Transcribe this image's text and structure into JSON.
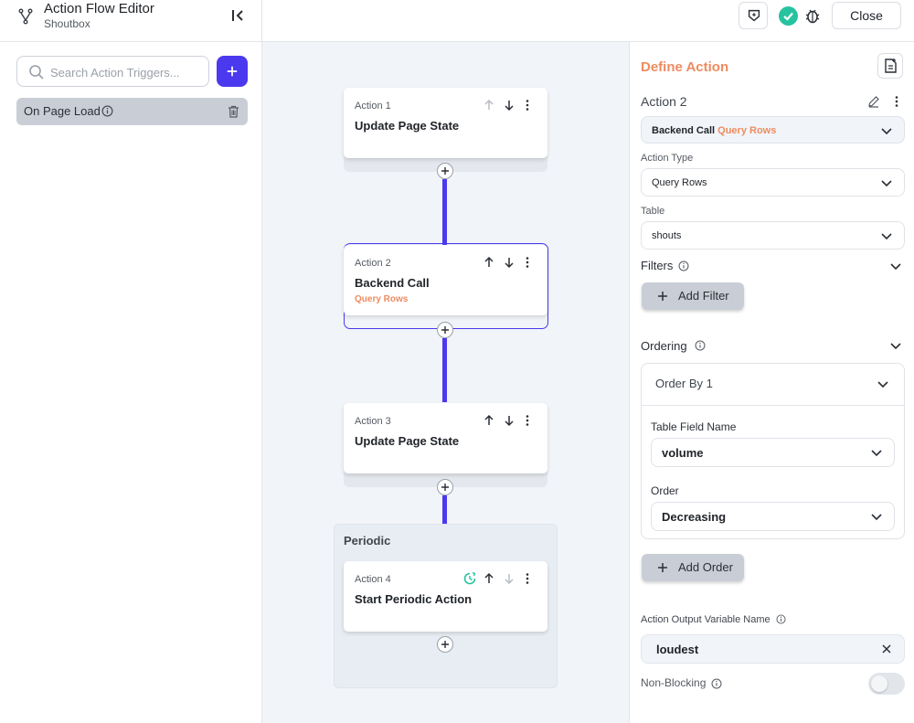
{
  "header": {
    "title": "Action Flow Editor",
    "subtitle": "Shoutbox",
    "close_label": "Close",
    "icons": [
      "flow-icon",
      "collapse-sidebar-icon",
      "debug-flag-icon",
      "check-circle-icon",
      "bug-icon"
    ]
  },
  "triggers": {
    "search_placeholder": "Search Action Triggers...",
    "items": [
      {
        "label": "On Page Load"
      }
    ]
  },
  "flow": {
    "actions": [
      {
        "label": "Action 1",
        "title": "Update Page State",
        "subtitle": ""
      },
      {
        "label": "Action 2",
        "title": "Backend Call",
        "subtitle": "Query Rows",
        "selected": true
      },
      {
        "label": "Action 3",
        "title": "Update Page State",
        "subtitle": ""
      },
      {
        "label": "Action 4",
        "title": "Start Periodic Action",
        "subtitle": ""
      }
    ],
    "periodic_label": "Periodic"
  },
  "panel": {
    "title": "Define Action",
    "action_label": "Action 2",
    "action_select": {
      "main": "Backend Call",
      "accent": "Query Rows"
    },
    "action_type_label": "Action Type",
    "action_type_value": "Query Rows",
    "table_label": "Table",
    "table_value": "shouts",
    "filters_label": "Filters",
    "add_filter_label": "Add Filter",
    "ordering_label": "Ordering",
    "order_by": {
      "title": "Order By 1",
      "field_name_label": "Table Field Name",
      "field_name_value": "volume",
      "order_label": "Order",
      "order_value": "Decreasing"
    },
    "add_order_label": "Add Order",
    "output_label": "Action Output Variable Name",
    "output_value": "loudest",
    "non_blocking_label": "Non-Blocking",
    "non_blocking_on": false
  },
  "colors": {
    "accent": "#4b39ef",
    "secondary": "#ee8b60",
    "success": "#27c3a0"
  }
}
